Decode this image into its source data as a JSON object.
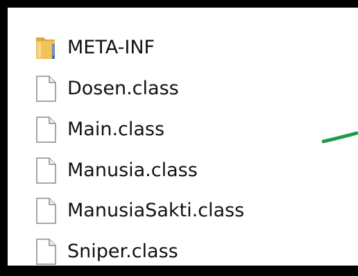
{
  "colors": {
    "frame_border": "#000000",
    "panel_background": "#ffffff",
    "folder_yellow": "#e8b64a",
    "folder_blue_stripe": "#6b8fbf",
    "file_outline": "#8a8a8a",
    "text": "#111111",
    "green_stroke": "#1f9a4a"
  },
  "files": [
    {
      "name": "META-INF",
      "icon": "folder-icon"
    },
    {
      "name": "Dosen.class",
      "icon": "file-icon"
    },
    {
      "name": "Main.class",
      "icon": "file-icon"
    },
    {
      "name": "Manusia.class",
      "icon": "file-icon"
    },
    {
      "name": "ManusiaSakti.class",
      "icon": "file-icon"
    },
    {
      "name": "Sniper.class",
      "icon": "file-icon"
    }
  ]
}
